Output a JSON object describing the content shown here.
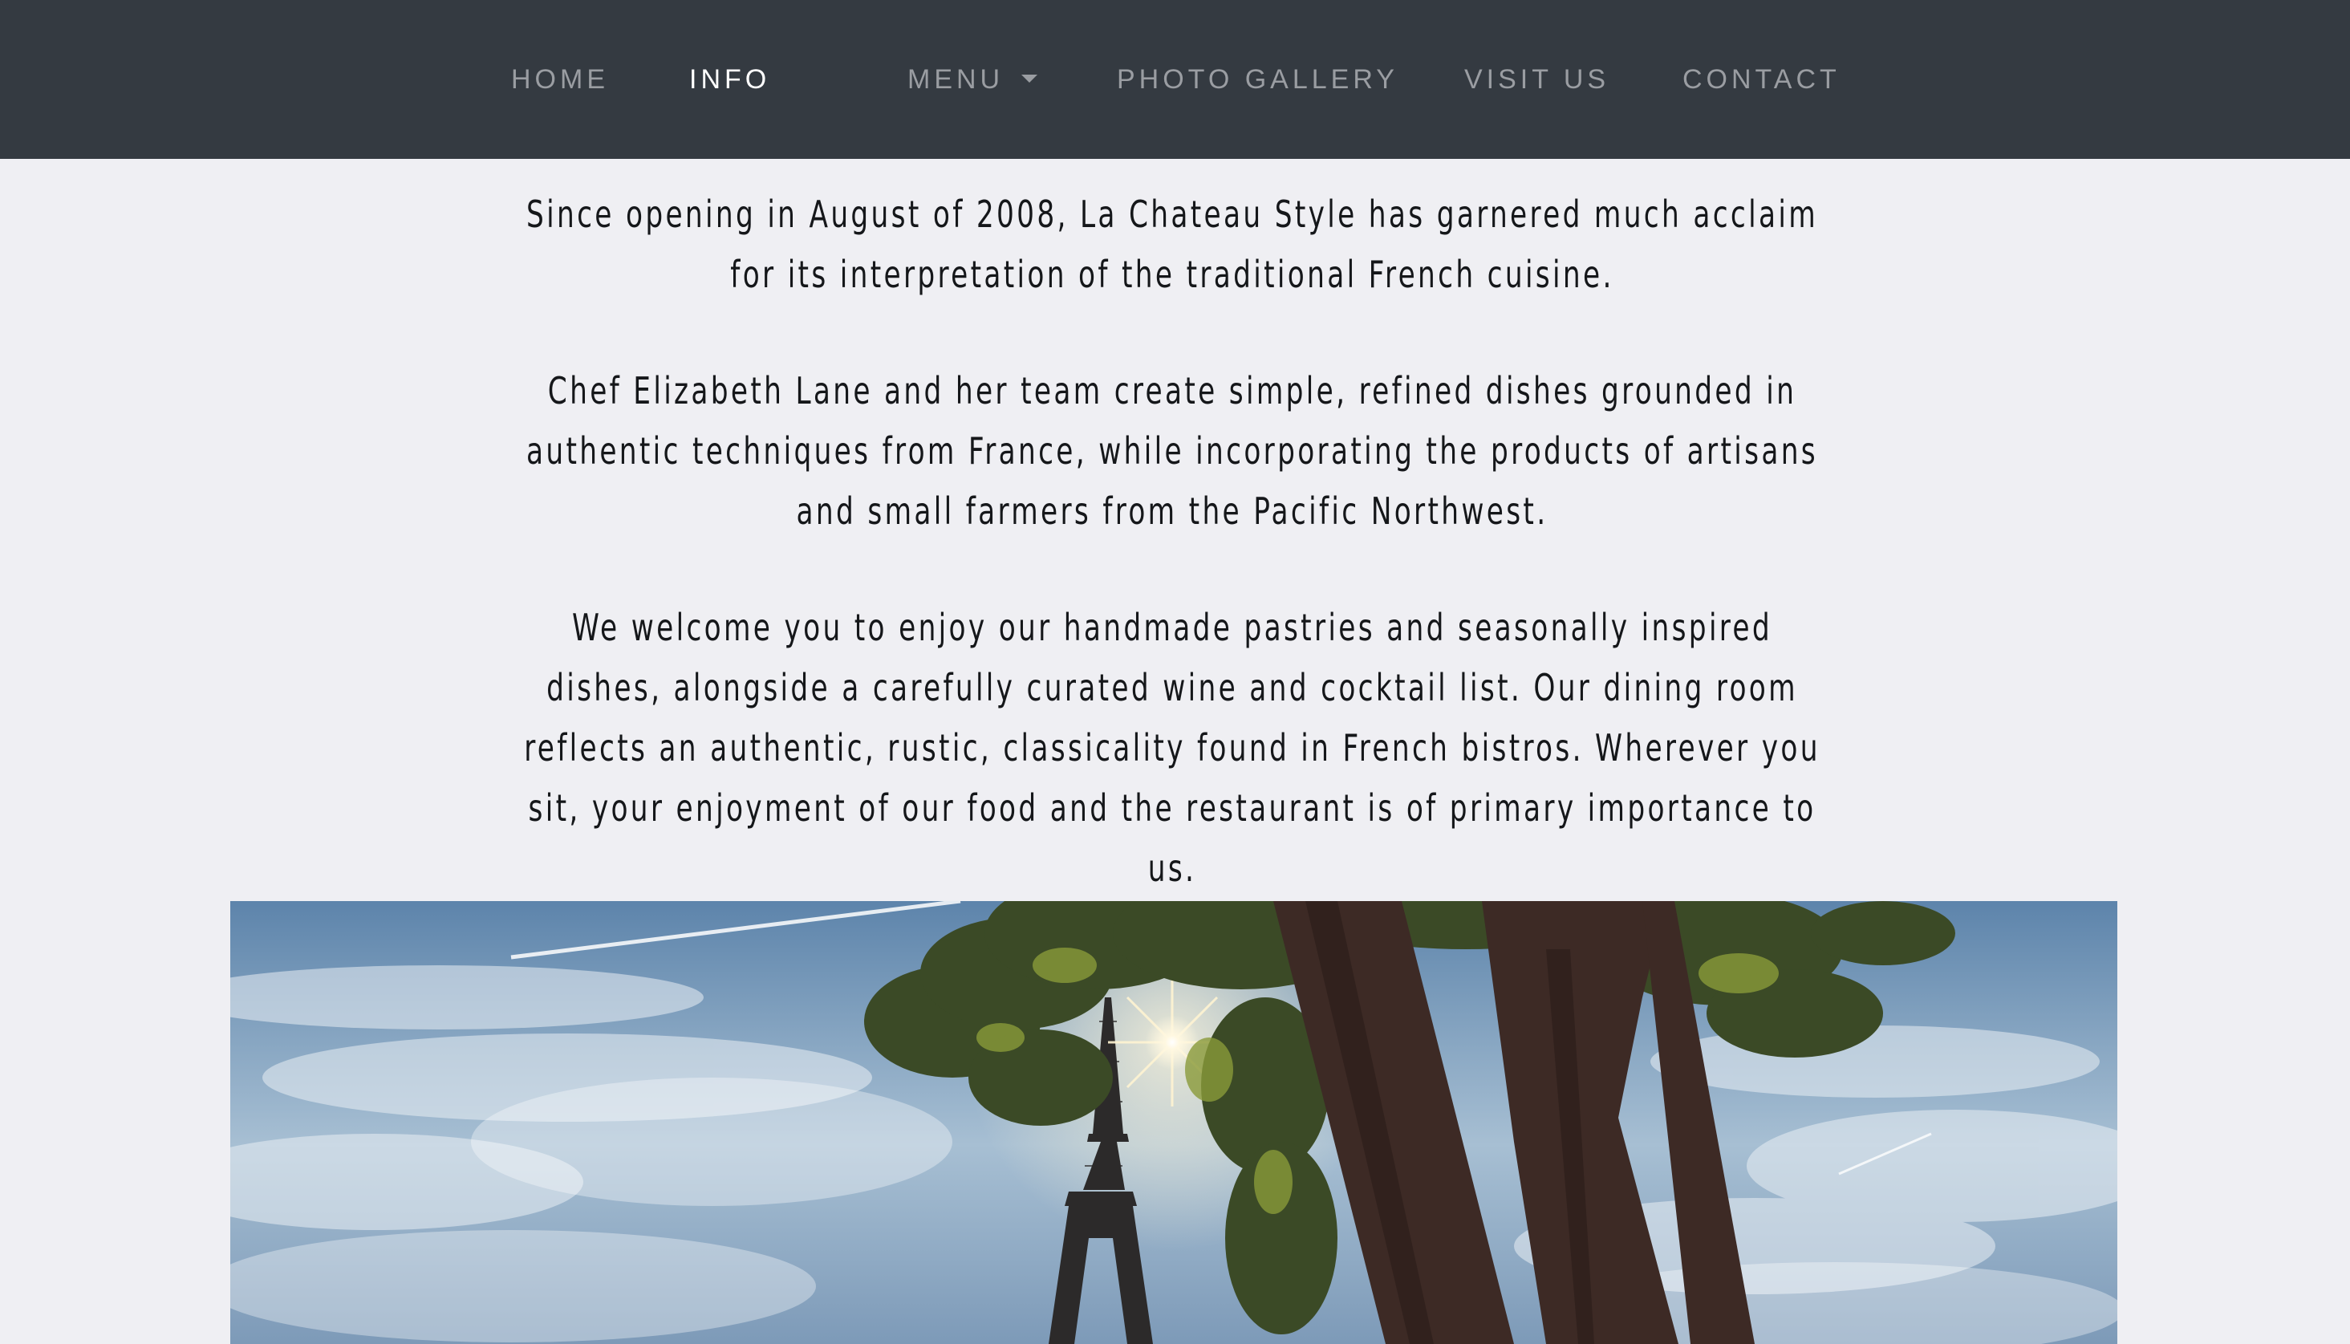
{
  "nav": {
    "home": "HOME",
    "info": "INFO",
    "menu": "MENU",
    "gallery": "PHOTO GALLERY",
    "visit": "VISIT US",
    "contact": "CONTACT",
    "active": "INFO"
  },
  "intro": {
    "p1": "Since opening in August of 2008, La Chateau Style has garnered much acclaim for its interpretation of the traditional French cuisine.",
    "p2": "Chef Elizabeth Lane and her team create simple, refined dishes grounded in authentic techniques from France, while incorporating the products of artisans and small farmers from the Pacific Northwest.",
    "p3": "We welcome you to enjoy our handmade pastries and seasonally inspired dishes, alongside a carefully curated wine and cocktail list. Our dining room reflects an authentic, rustic, classicality found in French bistros. Wherever you sit, your enjoyment of our food and the restaurant is of primary importance to us."
  },
  "hero": {
    "icon": "eiffel-tower-photo"
  },
  "colors": {
    "navbar_bg": "#343a41",
    "nav_text": "#9a9da2",
    "nav_active": "#ffffff",
    "page_bg": "#efeff3",
    "body_text": "#15171a"
  }
}
